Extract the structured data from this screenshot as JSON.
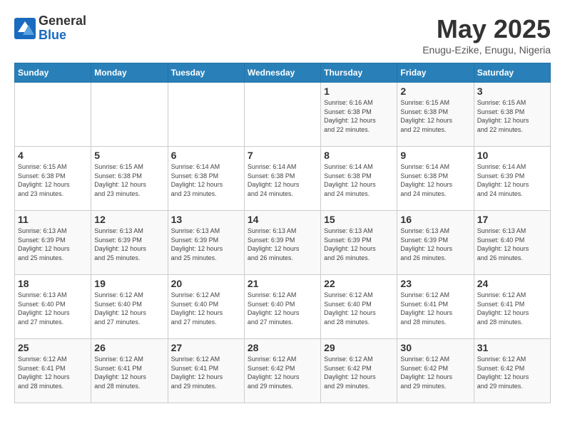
{
  "logo": {
    "general": "General",
    "blue": "Blue"
  },
  "title": "May 2025",
  "location": "Enugu-Ezike, Enugu, Nigeria",
  "days_of_week": [
    "Sunday",
    "Monday",
    "Tuesday",
    "Wednesday",
    "Thursday",
    "Friday",
    "Saturday"
  ],
  "weeks": [
    [
      {
        "day": "",
        "info": ""
      },
      {
        "day": "",
        "info": ""
      },
      {
        "day": "",
        "info": ""
      },
      {
        "day": "",
        "info": ""
      },
      {
        "day": "1",
        "info": "Sunrise: 6:16 AM\nSunset: 6:38 PM\nDaylight: 12 hours\nand 22 minutes."
      },
      {
        "day": "2",
        "info": "Sunrise: 6:15 AM\nSunset: 6:38 PM\nDaylight: 12 hours\nand 22 minutes."
      },
      {
        "day": "3",
        "info": "Sunrise: 6:15 AM\nSunset: 6:38 PM\nDaylight: 12 hours\nand 22 minutes."
      }
    ],
    [
      {
        "day": "4",
        "info": "Sunrise: 6:15 AM\nSunset: 6:38 PM\nDaylight: 12 hours\nand 23 minutes."
      },
      {
        "day": "5",
        "info": "Sunrise: 6:15 AM\nSunset: 6:38 PM\nDaylight: 12 hours\nand 23 minutes."
      },
      {
        "day": "6",
        "info": "Sunrise: 6:14 AM\nSunset: 6:38 PM\nDaylight: 12 hours\nand 23 minutes."
      },
      {
        "day": "7",
        "info": "Sunrise: 6:14 AM\nSunset: 6:38 PM\nDaylight: 12 hours\nand 24 minutes."
      },
      {
        "day": "8",
        "info": "Sunrise: 6:14 AM\nSunset: 6:38 PM\nDaylight: 12 hours\nand 24 minutes."
      },
      {
        "day": "9",
        "info": "Sunrise: 6:14 AM\nSunset: 6:38 PM\nDaylight: 12 hours\nand 24 minutes."
      },
      {
        "day": "10",
        "info": "Sunrise: 6:14 AM\nSunset: 6:39 PM\nDaylight: 12 hours\nand 24 minutes."
      }
    ],
    [
      {
        "day": "11",
        "info": "Sunrise: 6:13 AM\nSunset: 6:39 PM\nDaylight: 12 hours\nand 25 minutes."
      },
      {
        "day": "12",
        "info": "Sunrise: 6:13 AM\nSunset: 6:39 PM\nDaylight: 12 hours\nand 25 minutes."
      },
      {
        "day": "13",
        "info": "Sunrise: 6:13 AM\nSunset: 6:39 PM\nDaylight: 12 hours\nand 25 minutes."
      },
      {
        "day": "14",
        "info": "Sunrise: 6:13 AM\nSunset: 6:39 PM\nDaylight: 12 hours\nand 26 minutes."
      },
      {
        "day": "15",
        "info": "Sunrise: 6:13 AM\nSunset: 6:39 PM\nDaylight: 12 hours\nand 26 minutes."
      },
      {
        "day": "16",
        "info": "Sunrise: 6:13 AM\nSunset: 6:39 PM\nDaylight: 12 hours\nand 26 minutes."
      },
      {
        "day": "17",
        "info": "Sunrise: 6:13 AM\nSunset: 6:40 PM\nDaylight: 12 hours\nand 26 minutes."
      }
    ],
    [
      {
        "day": "18",
        "info": "Sunrise: 6:13 AM\nSunset: 6:40 PM\nDaylight: 12 hours\nand 27 minutes."
      },
      {
        "day": "19",
        "info": "Sunrise: 6:12 AM\nSunset: 6:40 PM\nDaylight: 12 hours\nand 27 minutes."
      },
      {
        "day": "20",
        "info": "Sunrise: 6:12 AM\nSunset: 6:40 PM\nDaylight: 12 hours\nand 27 minutes."
      },
      {
        "day": "21",
        "info": "Sunrise: 6:12 AM\nSunset: 6:40 PM\nDaylight: 12 hours\nand 27 minutes."
      },
      {
        "day": "22",
        "info": "Sunrise: 6:12 AM\nSunset: 6:40 PM\nDaylight: 12 hours\nand 28 minutes."
      },
      {
        "day": "23",
        "info": "Sunrise: 6:12 AM\nSunset: 6:41 PM\nDaylight: 12 hours\nand 28 minutes."
      },
      {
        "day": "24",
        "info": "Sunrise: 6:12 AM\nSunset: 6:41 PM\nDaylight: 12 hours\nand 28 minutes."
      }
    ],
    [
      {
        "day": "25",
        "info": "Sunrise: 6:12 AM\nSunset: 6:41 PM\nDaylight: 12 hours\nand 28 minutes."
      },
      {
        "day": "26",
        "info": "Sunrise: 6:12 AM\nSunset: 6:41 PM\nDaylight: 12 hours\nand 28 minutes."
      },
      {
        "day": "27",
        "info": "Sunrise: 6:12 AM\nSunset: 6:41 PM\nDaylight: 12 hours\nand 29 minutes."
      },
      {
        "day": "28",
        "info": "Sunrise: 6:12 AM\nSunset: 6:42 PM\nDaylight: 12 hours\nand 29 minutes."
      },
      {
        "day": "29",
        "info": "Sunrise: 6:12 AM\nSunset: 6:42 PM\nDaylight: 12 hours\nand 29 minutes."
      },
      {
        "day": "30",
        "info": "Sunrise: 6:12 AM\nSunset: 6:42 PM\nDaylight: 12 hours\nand 29 minutes."
      },
      {
        "day": "31",
        "info": "Sunrise: 6:12 AM\nSunset: 6:42 PM\nDaylight: 12 hours\nand 29 minutes."
      }
    ]
  ]
}
